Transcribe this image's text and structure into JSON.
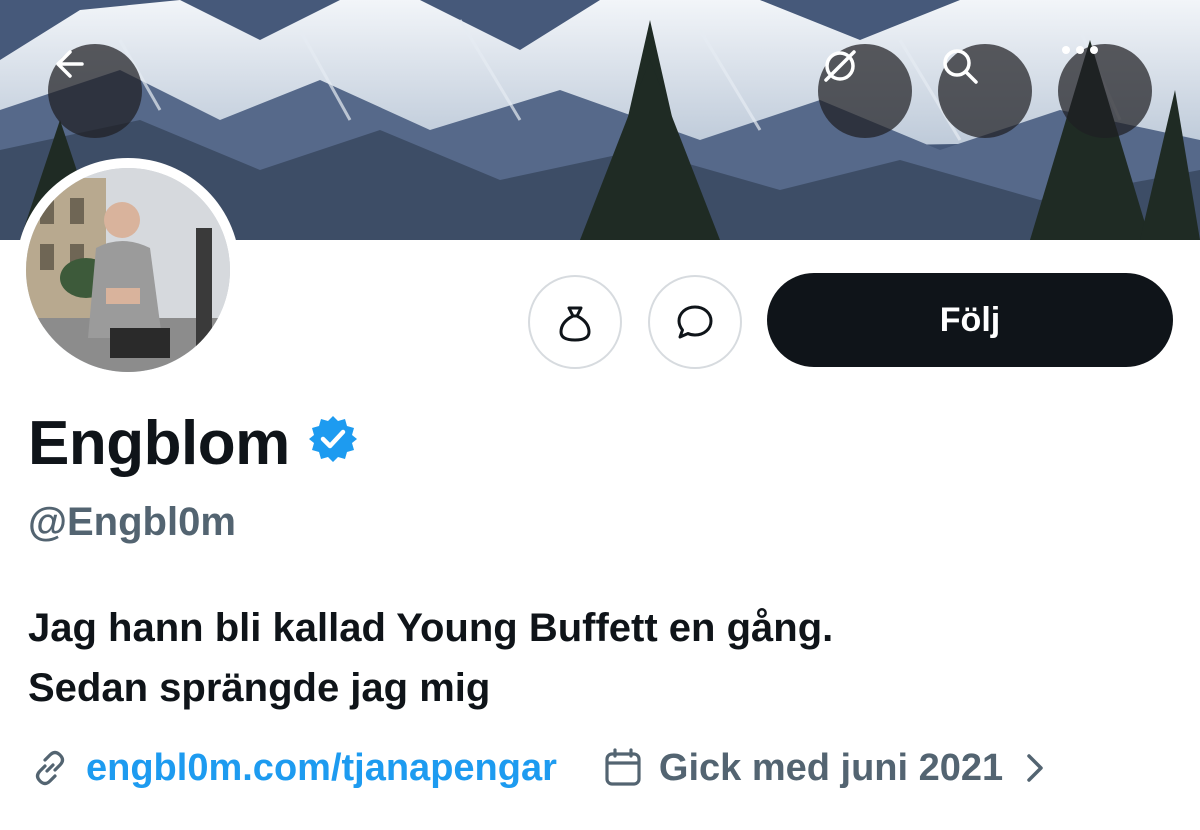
{
  "header": {
    "back_icon": "arrow-left-icon",
    "actions": [
      "no-signal-icon",
      "search-icon",
      "more-icon"
    ]
  },
  "profile": {
    "display_name": "Engblom",
    "verified": true,
    "verified_color": "#1d9bf0",
    "handle": "@Engbl0m",
    "bio_lines": [
      "Jag hann bli kallad Young Buffett en gång.",
      "Sedan sprängde jag mig"
    ],
    "website": "engbl0m.com/tjanapengar",
    "joined": "Gick med juni 2021"
  },
  "buttons": {
    "follow_label": "Följ",
    "tip_icon": "money-bag-icon",
    "message_icon": "chat-bubble-icon"
  },
  "colors": {
    "primary_text": "#0f1419",
    "secondary_text": "#536471",
    "link": "#1d9bf0",
    "follow_bg": "#0f1419"
  }
}
